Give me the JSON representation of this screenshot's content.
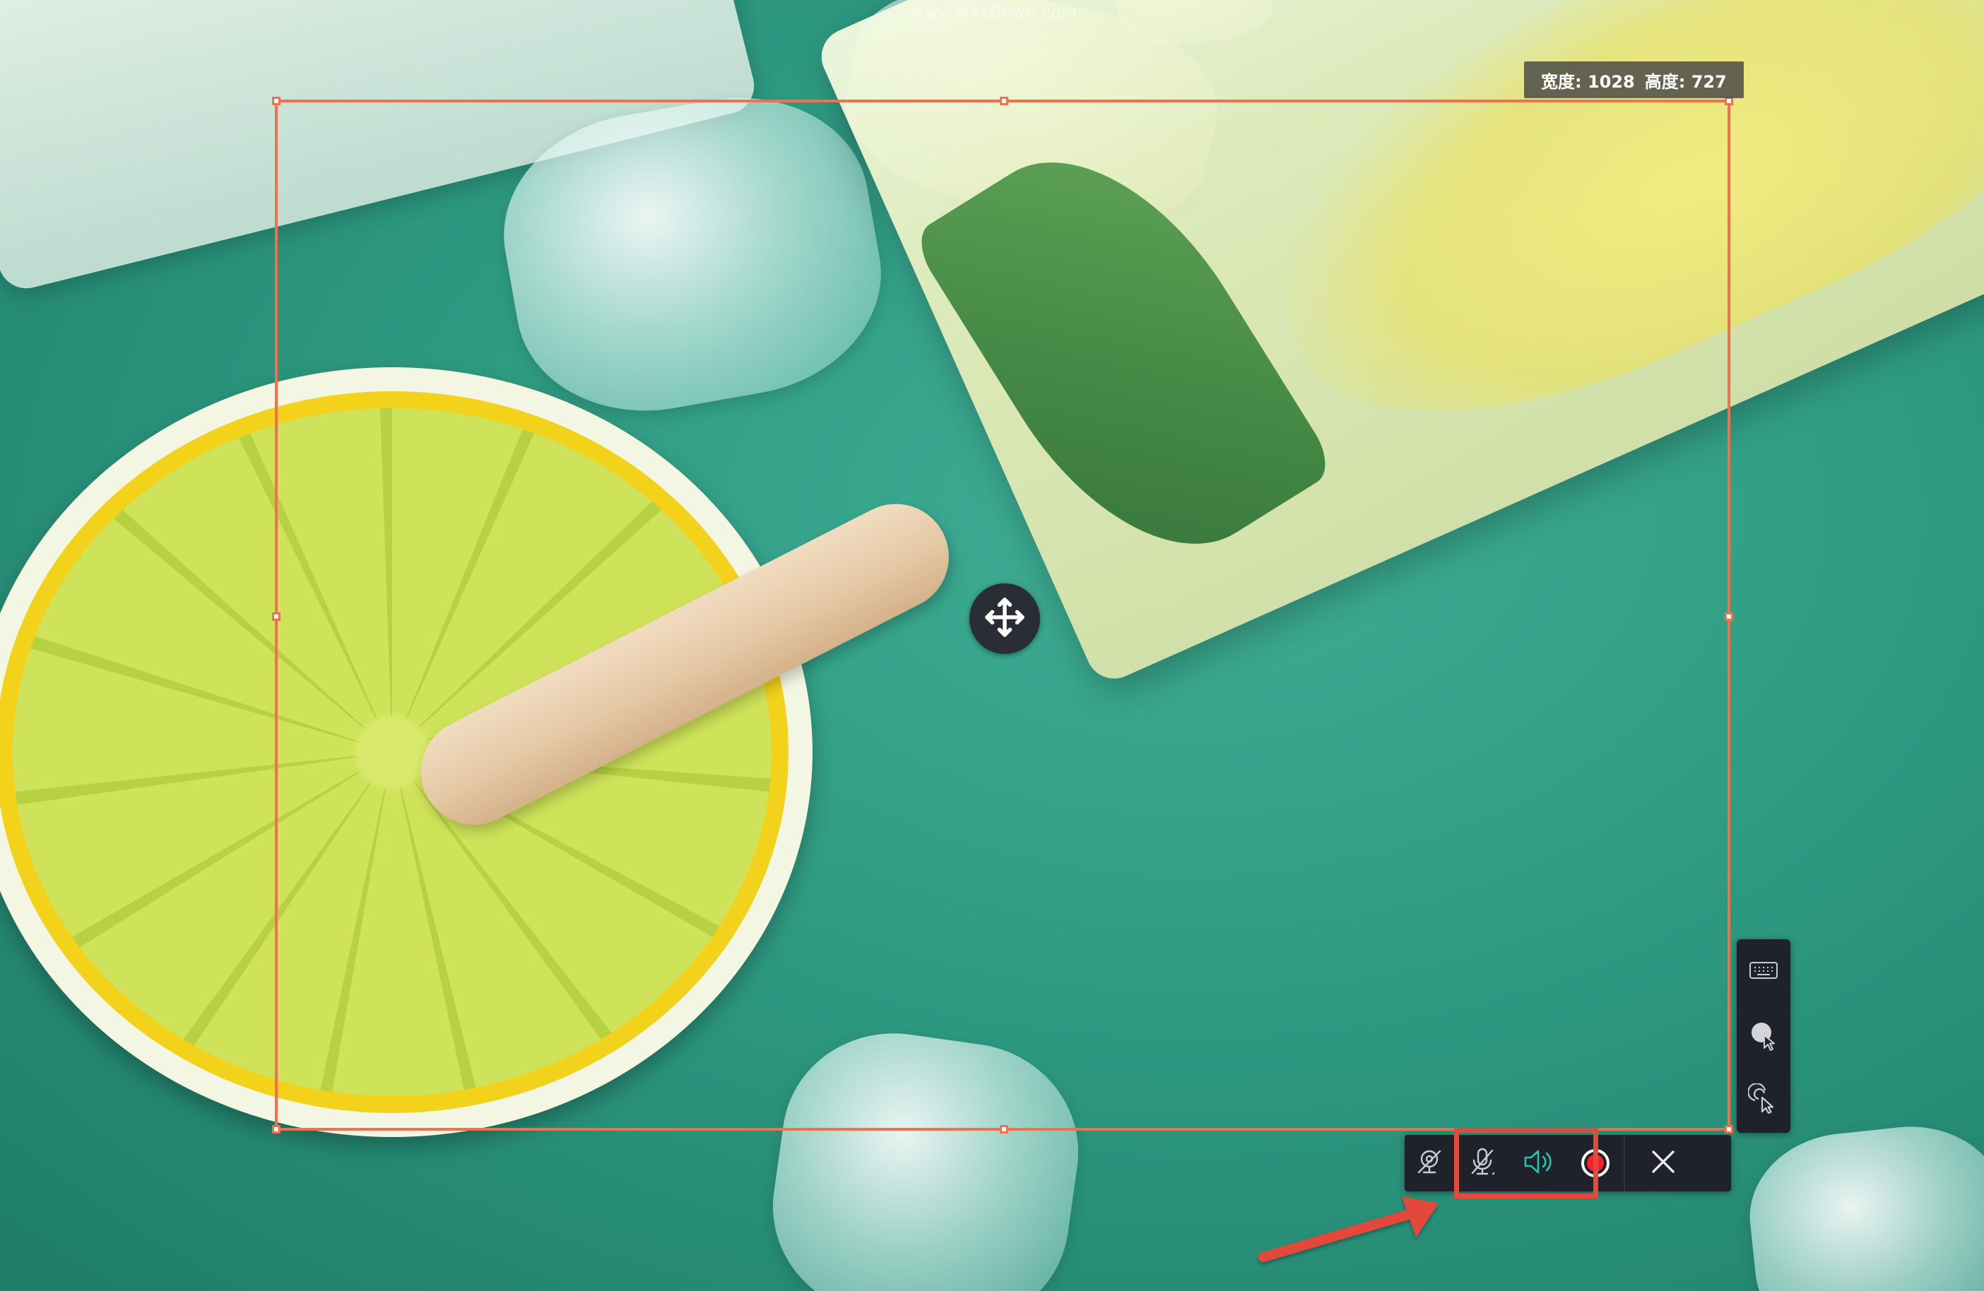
{
  "watermark": {
    "text": "www.MacDown.com"
  },
  "selection": {
    "width_label": "宽度: 1028",
    "height_label": "高度: 727",
    "border_color": "#f2704b"
  },
  "side_panel": {
    "items": [
      {
        "icon": "keyboard-icon"
      },
      {
        "icon": "cursor-highlight-icon"
      },
      {
        "icon": "click-cursor-icon"
      }
    ]
  },
  "toolbar": {
    "buttons": [
      {
        "icon": "webcam-off-icon",
        "state": "off"
      },
      {
        "icon": "microphone-off-icon",
        "state": "off"
      },
      {
        "icon": "system-sound-icon",
        "state": "on",
        "color": "#1fc9b0"
      },
      {
        "icon": "record-icon",
        "color": "#ff1e2d"
      },
      {
        "icon": "close-icon"
      }
    ]
  },
  "annotation": {
    "color": "#e24a3a"
  }
}
